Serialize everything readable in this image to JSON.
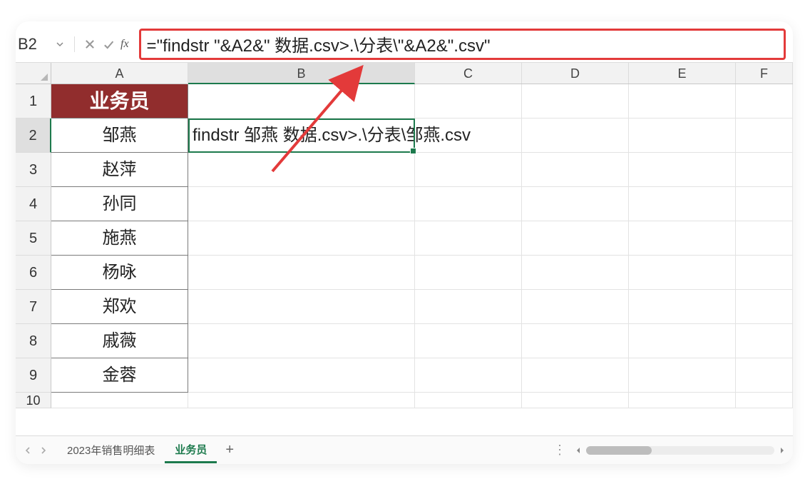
{
  "name_box": {
    "value": "B2"
  },
  "formula_bar": {
    "text": "=\"findstr \"&A2&\" 数据.csv>.\\分表\\\"&A2&\".csv\""
  },
  "columns": [
    "A",
    "B",
    "C",
    "D",
    "E",
    "F"
  ],
  "row_headers": [
    "1",
    "2",
    "3",
    "4",
    "5",
    "6",
    "7",
    "8",
    "9",
    "10"
  ],
  "header": {
    "A": "业务员"
  },
  "colA": [
    "邹燕",
    "赵萍",
    "孙同",
    "施燕",
    "杨咏",
    "郑欢",
    "戚薇",
    "金蓉"
  ],
  "b2_display": "findstr 邹燕 数据.csv>.\\分表\\邹燕.csv",
  "tabs": {
    "items": [
      {
        "label": "2023年销售明细表",
        "active": false
      },
      {
        "label": "业务员",
        "active": true
      }
    ],
    "add": "+"
  },
  "misc_dots": "⋮"
}
